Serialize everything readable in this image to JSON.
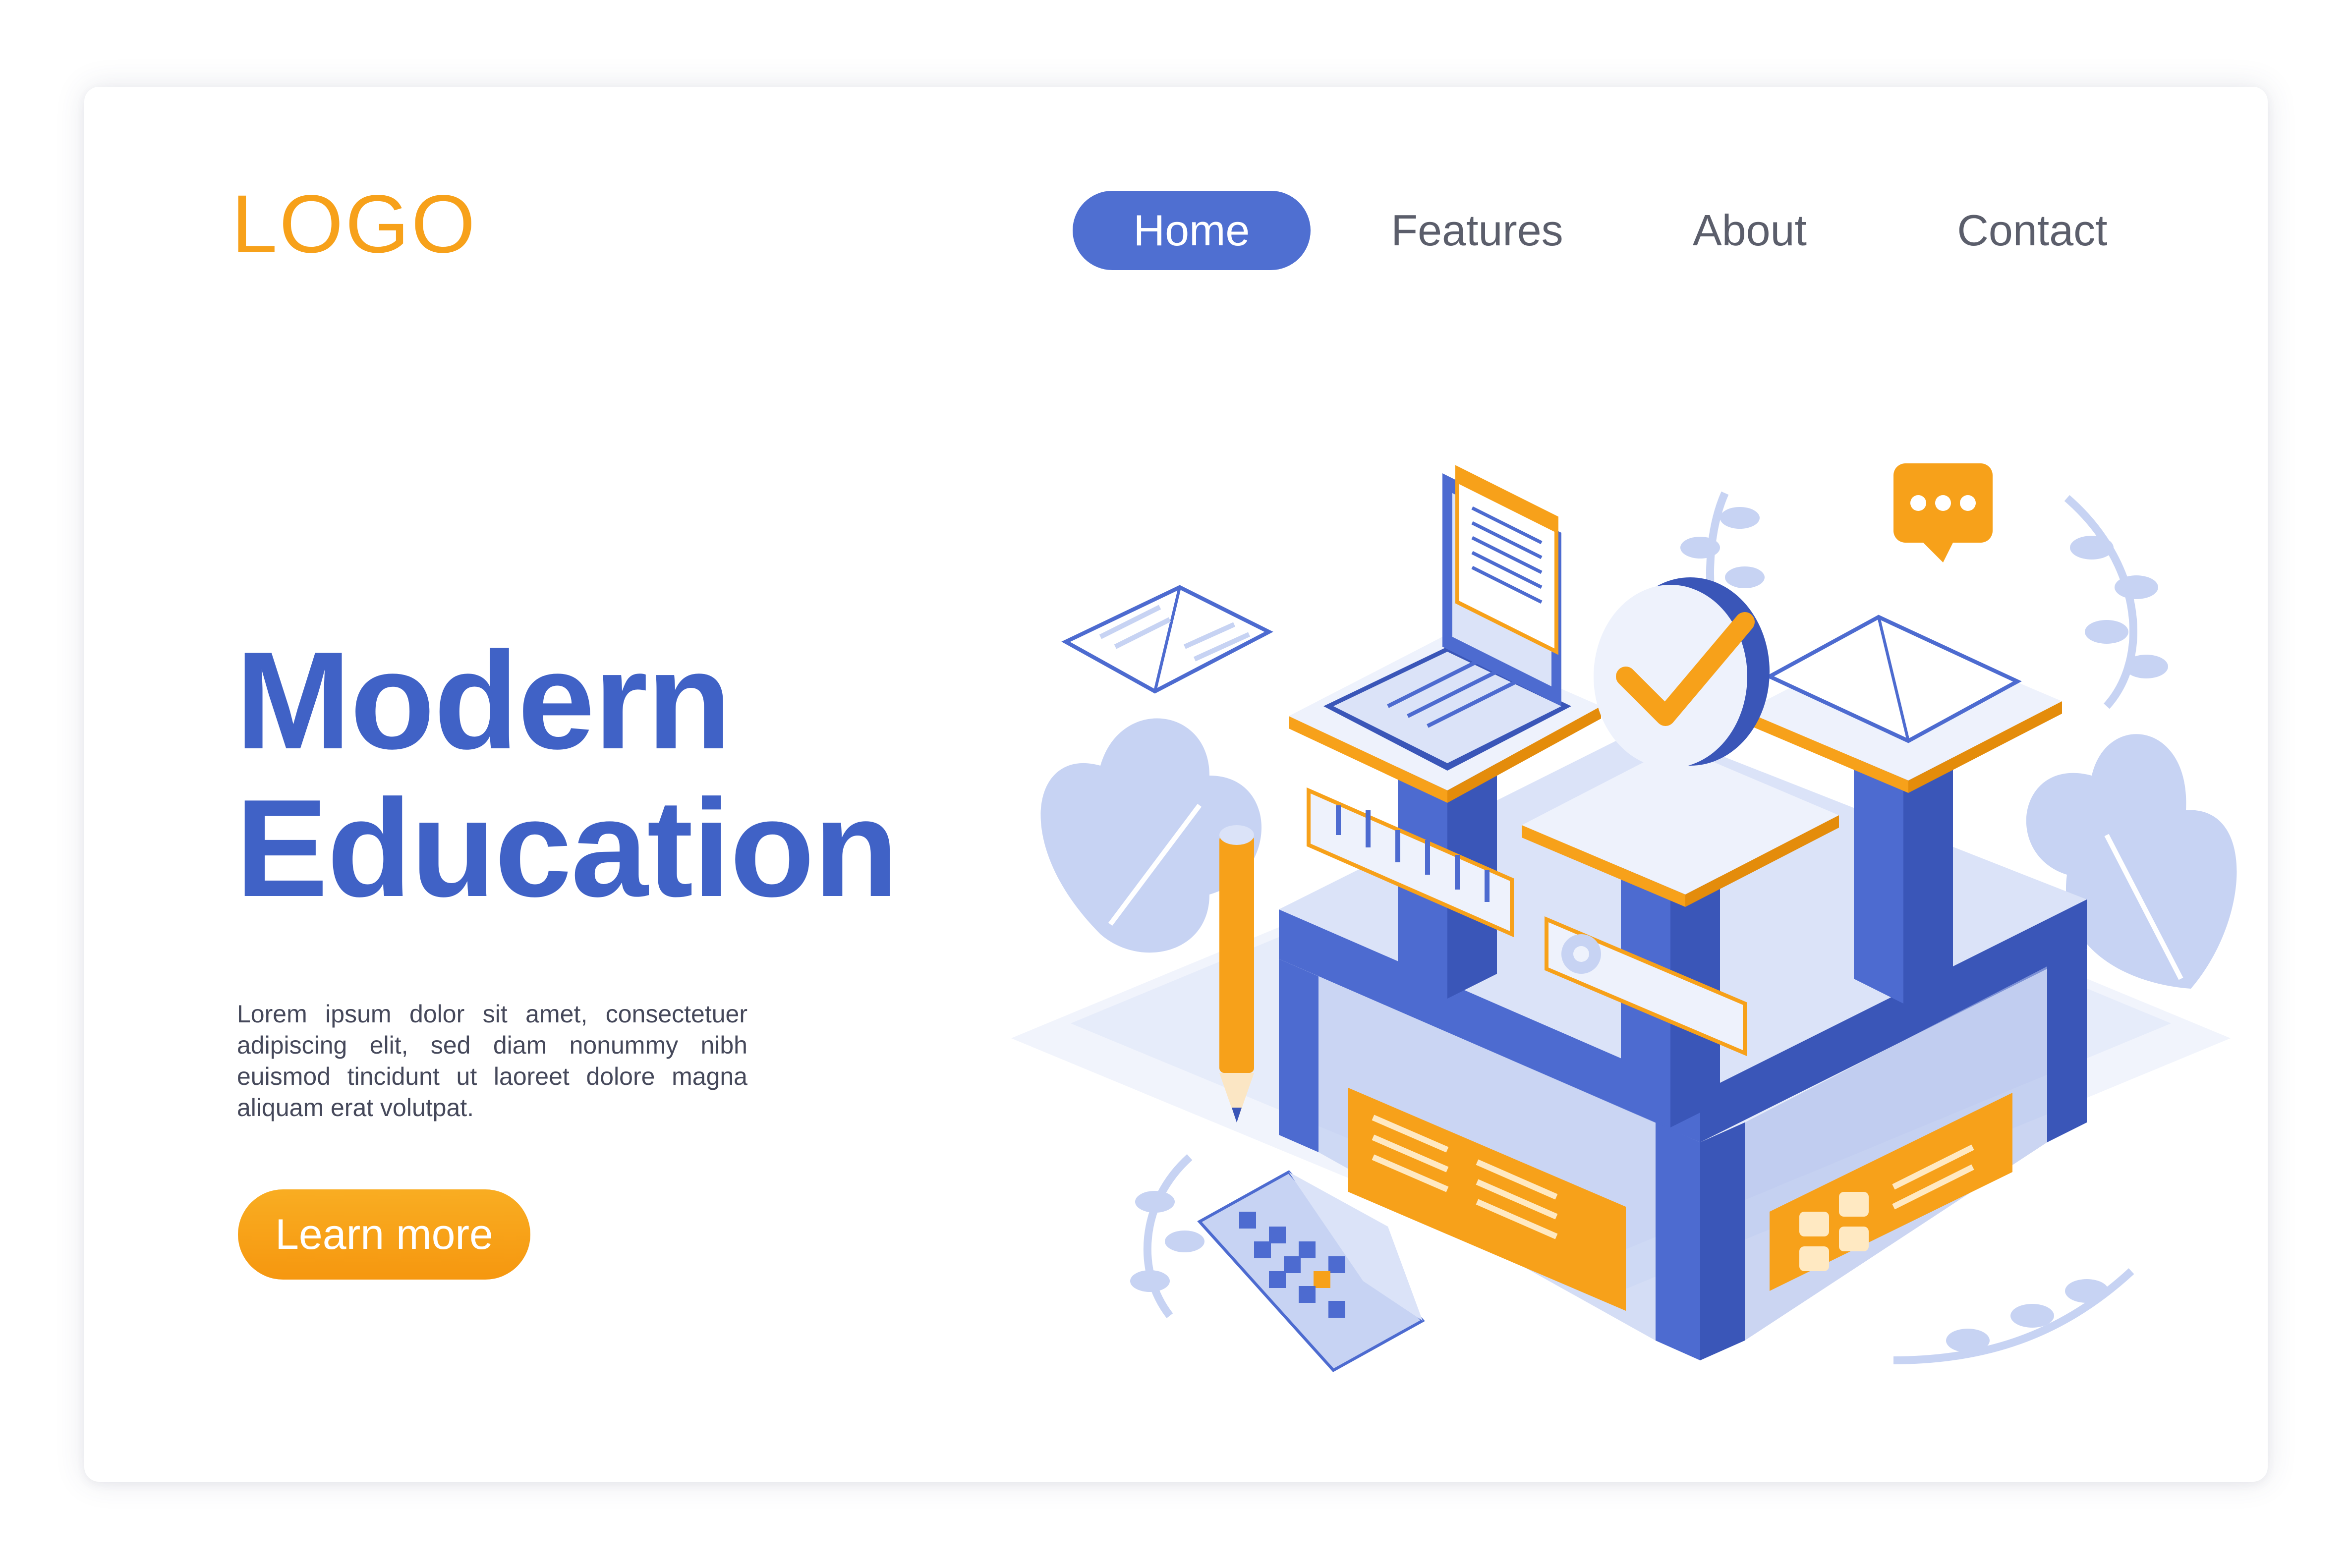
{
  "colors": {
    "brand_orange": "#f7a11a",
    "primary_blue": "#4f6fd1",
    "title_blue": "#4062c6",
    "text_gray": "#45485a",
    "light_blue": "#c7d3f3"
  },
  "header": {
    "logo": "LOGO",
    "nav": [
      {
        "label": "Home",
        "active": true
      },
      {
        "label": "Features",
        "active": false
      },
      {
        "label": "About",
        "active": false
      },
      {
        "label": "Contact",
        "active": false
      }
    ]
  },
  "hero": {
    "title_line1": "Modern",
    "title_line2": "Education",
    "body": "Lorem ipsum dolor sit amet, consectetuer adipiscing elit, sed diam nonummy nibh euismod tincidunt ut laoreet dolore magna aliquam erat volutpat.",
    "cta_label": "Learn more"
  },
  "illustration": {
    "icons": [
      "laptop-icon",
      "open-book-icon",
      "checkmark-icon",
      "chat-bubble-icon",
      "pencil-icon",
      "calendar-icon",
      "gear-icon",
      "chart-arrows-icon",
      "calculator-icon",
      "leaf-icon"
    ]
  }
}
